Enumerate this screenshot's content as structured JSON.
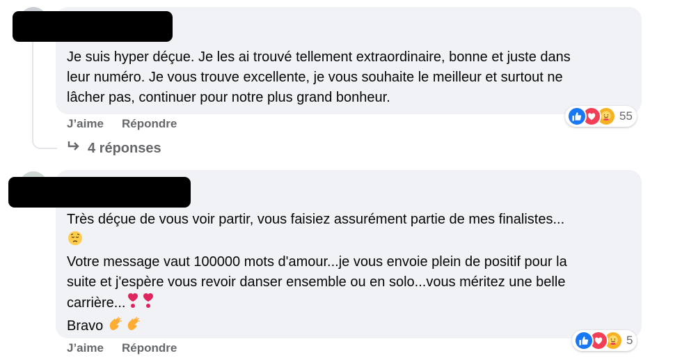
{
  "comments": [
    {
      "text_lines": [
        "Je suis hyper déçue. Je les ai trouvé tellement extraordinaire, bonne et juste dans",
        "leur numéro. Je vous trouve excellente, je vous souhaite le meilleur et surtout ne",
        "lâcher pas, continuer pour notre plus grand bonheur."
      ],
      "like_label": "J’aime",
      "reply_label": "Répondre",
      "reaction_count": "55",
      "reactions": [
        "like-icon",
        "love-icon",
        "care-icon"
      ],
      "replies_label": "4 réponses"
    },
    {
      "text_lines": [
        "Très déçue de vous voir partir, vous faisiez assurément partie de mes finalistes...",
        "",
        "Votre message vaut 100000 mots d'amour...je vous envoie plein de positif pour la",
        "suite et j'espère vous revoir danser ensemble ou en solo...vous méritez une belle",
        "carrière...",
        "Bravo"
      ],
      "emojis": [
        "pensive-face",
        "heart-exclamation",
        "heart-exclamation",
        "clapping-hands",
        "clapping-hands"
      ],
      "like_label": "J’aime",
      "reply_label": "Répondre",
      "reaction_count": "5",
      "reactions": [
        "like-icon",
        "love-icon",
        "care-icon"
      ]
    }
  ],
  "colors": {
    "bubble": "#f0f2f5",
    "secondary_text": "#65676b",
    "like": "#1877f2",
    "love": "#f33e58",
    "care": "#f7b125"
  }
}
